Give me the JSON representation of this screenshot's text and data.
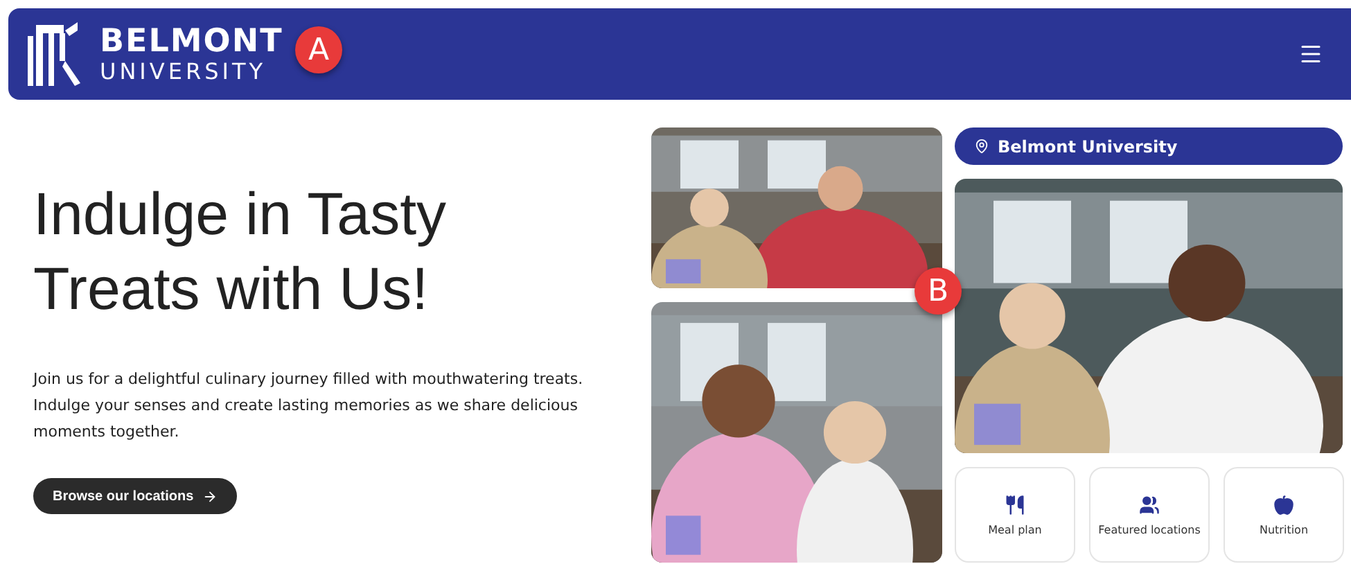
{
  "header": {
    "logo_line_1": "BELMONT",
    "logo_line_2": "UNIVERSITY",
    "marker": "A"
  },
  "photos": {
    "marker": "B"
  },
  "hero": {
    "title": "Indulge in Tasty Treats with Us!",
    "text": "Join us for a delightful culinary journey filled with mouthwatering treats. Indulge your senses and create lasting memories as we share delicious moments together.",
    "button": "Browse our locations"
  },
  "location": {
    "label": "Belmont University"
  },
  "quick_links": [
    {
      "label": "Meal plan",
      "kind": "meal"
    },
    {
      "label": "Featured locations",
      "kind": "locations"
    },
    {
      "label": "Nutrition",
      "kind": "nutrition"
    }
  ]
}
